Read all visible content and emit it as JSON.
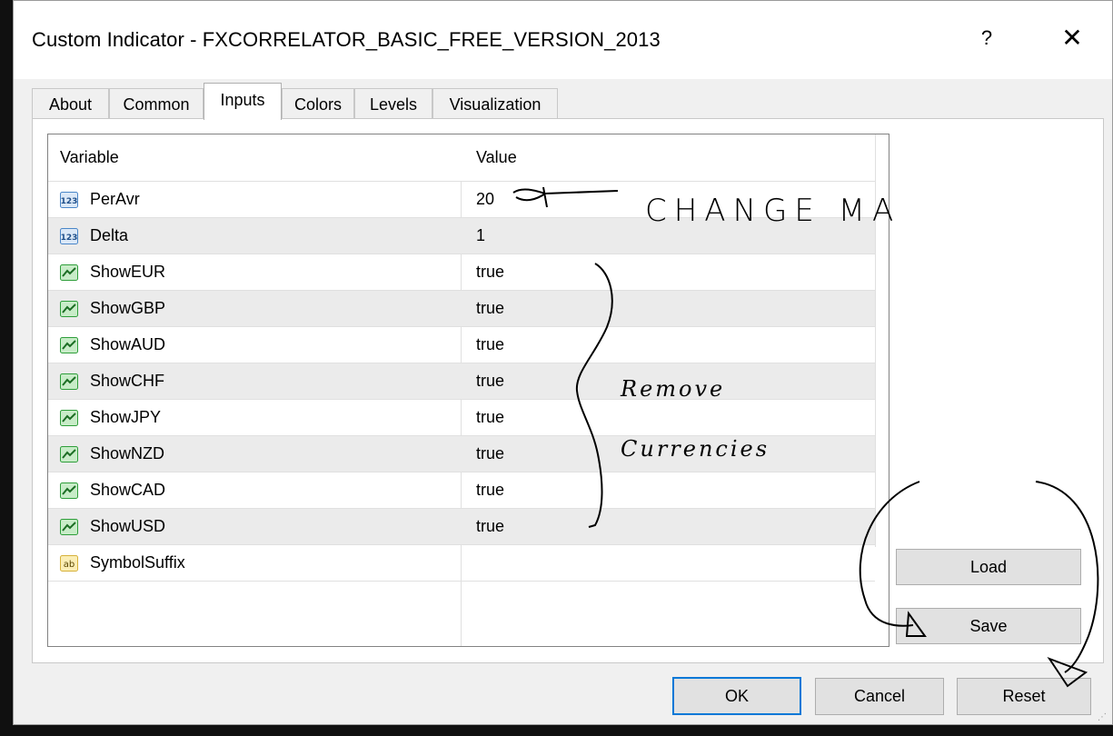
{
  "window": {
    "title": "Custom Indicator - FXCORRELATOR_BASIC_FREE_VERSION_2013",
    "help_label": "?",
    "close_label": "✕"
  },
  "tabs": [
    {
      "label": "About",
      "active": false
    },
    {
      "label": "Common",
      "active": false
    },
    {
      "label": "Inputs",
      "active": true
    },
    {
      "label": "Colors",
      "active": false
    },
    {
      "label": "Levels",
      "active": false
    },
    {
      "label": "Visualization",
      "active": false
    }
  ],
  "grid": {
    "header": {
      "variable": "Variable",
      "value": "Value"
    },
    "rows": [
      {
        "icon": "integer-icon",
        "name": "PerAvr",
        "value": "20"
      },
      {
        "icon": "integer-icon",
        "name": "Delta",
        "value": "1"
      },
      {
        "icon": "boolean-icon",
        "name": "ShowEUR",
        "value": "true"
      },
      {
        "icon": "boolean-icon",
        "name": "ShowGBP",
        "value": "true"
      },
      {
        "icon": "boolean-icon",
        "name": "ShowAUD",
        "value": "true"
      },
      {
        "icon": "boolean-icon",
        "name": "ShowCHF",
        "value": "true"
      },
      {
        "icon": "boolean-icon",
        "name": "ShowJPY",
        "value": "true"
      },
      {
        "icon": "boolean-icon",
        "name": "ShowNZD",
        "value": "true"
      },
      {
        "icon": "boolean-icon",
        "name": "ShowCAD",
        "value": "true"
      },
      {
        "icon": "boolean-icon",
        "name": "ShowUSD",
        "value": "true"
      },
      {
        "icon": "string-icon",
        "name": "SymbolSuffix",
        "value": ""
      }
    ]
  },
  "side_buttons": {
    "load": "Load",
    "save": "Save"
  },
  "bottom_buttons": {
    "ok": "OK",
    "cancel": "Cancel",
    "reset": "Reset"
  },
  "annotations": {
    "change_ma": "CHANGE MA",
    "remove": "Remove",
    "currencies": "Currencies",
    "color": "#000000"
  },
  "colors": {
    "accent": "#0078d7",
    "int_icon": "#4a86c8",
    "bool_icon": "#2e9e3a",
    "string_icon": "#d6b13a"
  }
}
